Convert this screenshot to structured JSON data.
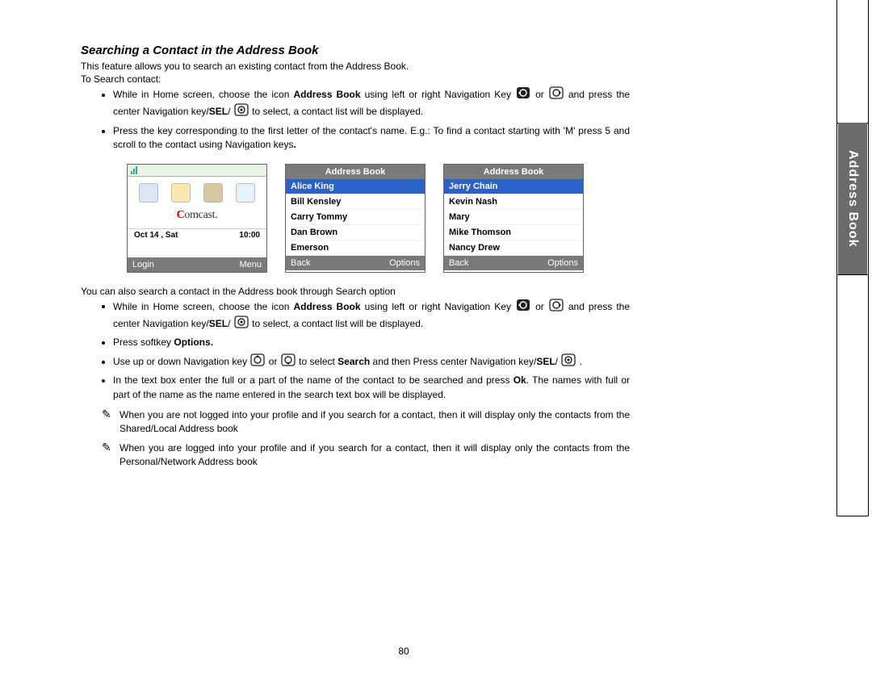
{
  "heading": "Searching a Contact in the Address Book",
  "intro1": "This feature allows you to search an existing contact from the Address Book.",
  "intro2": "To Search contact:",
  "b1a": "While in Home screen, choose the icon ",
  "b1b": "Address Book",
  "b1c": " using left or right Navigation Key ",
  "b1d": " or ",
  "b1e": " and press the center Navigation key/",
  "b1f": "SEL",
  "b1g": "/",
  "b1h": " to select, a contact list will be displayed.",
  "b2": "Press the key corresponding to the first letter of the contact's name. E.g.: To find a contact starting with 'M' press 5 and scroll to the contact using Navigation keys",
  "b2end": ".",
  "mid": "You can also search a contact in the Address book through Search option",
  "b3a": "While in Home screen, choose the icon ",
  "b3b": "Address Book",
  "b3c": " using left or right Navigation Key ",
  "b3d": " or ",
  "b3e": " and press the center Navigation key/",
  "b3f": "SEL",
  "b3g": "/",
  "b3h": " to select, a contact list will be displayed.",
  "b4a": "Press softkey ",
  "b4b": "Options.",
  "b5a": "Use up or down Navigation key ",
  "b5b": " or ",
  "b5c": " to select ",
  "b5d": "Search",
  "b5e": " and then Press center Navigation key/",
  "b5f": "SEL",
  "b5g": "/",
  "b5h": ".",
  "b6a": "In the text box enter the full or a part of the name of the contact to be searched and press ",
  "b6b": "Ok",
  "b6c": ". The names with full or part of the name as the name entered in the search text box will be displayed.",
  "note1": "When you are not logged into your profile and if you search for a contact, then it will display only the contacts from the Shared/Local Address book",
  "note2": "When you are logged into your profile and if you search for a contact, then it will display only the contacts from the Personal/Network Address book",
  "pageno": "80",
  "sideTab": "Address Book",
  "screens": {
    "home": {
      "date": "Oct 14 , Sat",
      "time": "10:00",
      "brand": "Comcast",
      "left": "Login",
      "right": "Menu"
    },
    "list1": {
      "title": "Address Book",
      "items": [
        "Alice King",
        "Bill Kensley",
        "Carry Tommy",
        "Dan Brown",
        "Emerson"
      ],
      "selected": 0,
      "left": "Back",
      "right": "Options"
    },
    "list2": {
      "title": "Address Book",
      "items": [
        "Jerry Chain",
        "Kevin Nash",
        "Mary",
        "Mike Thomson",
        "Nancy Drew"
      ],
      "selected": 0,
      "left": "Back",
      "right": "Options"
    }
  }
}
